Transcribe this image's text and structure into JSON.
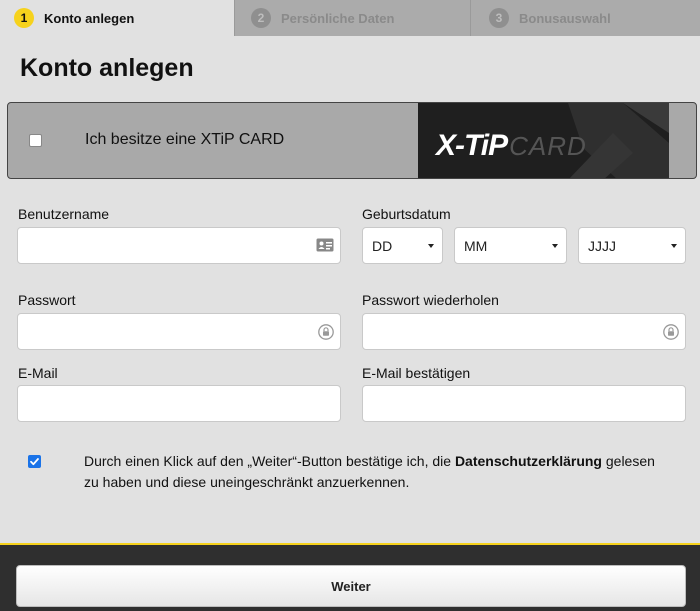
{
  "steps": [
    {
      "number": "1",
      "label": "Konto anlegen"
    },
    {
      "number": "2",
      "label": "Persönliche Daten"
    },
    {
      "number": "3",
      "label": "Bonusauswahl"
    }
  ],
  "page_title": "Konto anlegen",
  "card": {
    "checkbox_label": "Ich besitze eine XTiP CARD",
    "checked": false,
    "logo_brand": "X-TiP",
    "logo_card": "CARD"
  },
  "form": {
    "username": {
      "label": "Benutzername",
      "value": "",
      "icon": "id-card-icon"
    },
    "birthdate": {
      "label": "Geburtsdatum",
      "day": "DD",
      "month": "MM",
      "year": "JJJJ"
    },
    "password": {
      "label": "Passwort",
      "value": "",
      "icon": "lock-icon"
    },
    "password_repeat": {
      "label": "Passwort wiederholen",
      "value": "",
      "icon": "lock-icon"
    },
    "email": {
      "label": "E-Mail",
      "value": ""
    },
    "email_confirm": {
      "label": "E-Mail bestätigen",
      "value": ""
    }
  },
  "consent": {
    "checked": true,
    "text_before": "Durch einen Klick auf den „Weiter“-Button bestätige ich, die ",
    "link": "Datenschutzerklärung",
    "text_after": " gelesen zu haben und diese uneingeschränkt anzuerkennen."
  },
  "footer": {
    "next_label": "Weiter"
  },
  "colors": {
    "accent": "#f6d21c",
    "background": "#e1e1e1",
    "checkbox_blue": "#1a73e8",
    "footer": "#2f2f2f"
  }
}
